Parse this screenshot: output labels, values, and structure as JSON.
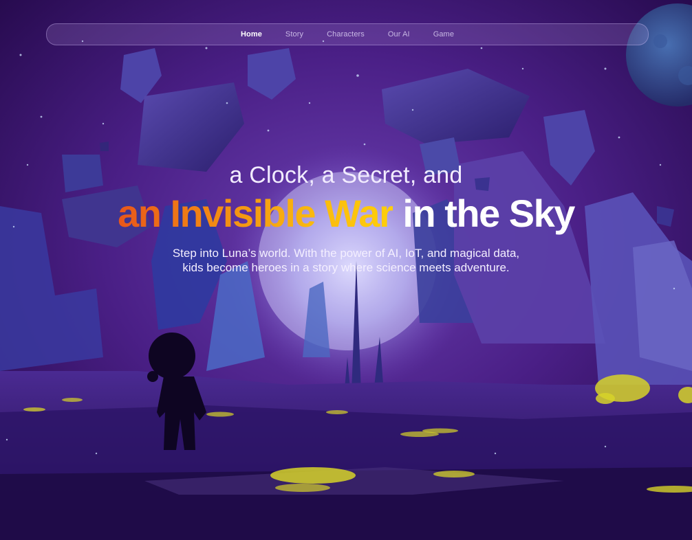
{
  "nav": {
    "items": [
      {
        "label": "Home",
        "active": true
      },
      {
        "label": "Story",
        "active": false
      },
      {
        "label": "Characters",
        "active": false
      },
      {
        "label": "Our AI",
        "active": false
      },
      {
        "label": "Game",
        "active": false
      }
    ]
  },
  "hero": {
    "line1": "a Clock, a Secret, and",
    "highlight": "an Invisible War",
    "rest": " in the Sky",
    "description_line1": "Step into Luna’s world. With the power of AI, IoT, and magical data,",
    "description_line2": "kids become heroes in a story where science meets adventure."
  },
  "colors": {
    "bg_deep": "#2a0f52",
    "gradient_start": "#e8561b",
    "gradient_end": "#ffcf0a",
    "glow": "#cfc8ff",
    "lily": "#d6d229"
  }
}
